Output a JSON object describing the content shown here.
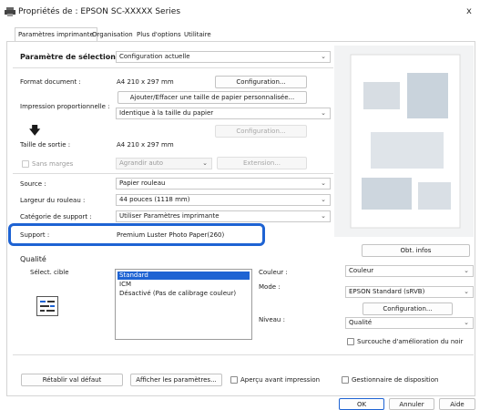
{
  "window": {
    "title": "Propriétés de : EPSON SC-XXXXX Series",
    "close_label": "x"
  },
  "tabs": [
    {
      "label": "Paramètres imprimante"
    },
    {
      "label": "Organisation"
    },
    {
      "label": "Plus d'options"
    },
    {
      "label": "Utilitaire"
    }
  ],
  "selection": {
    "label": "Paramètre de sélection :",
    "value": "Configuration actuelle"
  },
  "format": {
    "label": "Format document :",
    "value": "A4 210 x 297 mm",
    "config_button": "Configuration..."
  },
  "custom_size_button": "Ajouter/Effacer une taille de papier personnalisée...",
  "proportional": {
    "label": "Impression proportionnelle :",
    "value": "Identique à la taille du papier",
    "config_button": "Configuration..."
  },
  "arrow_glyph": "🡇",
  "output": {
    "label": "Taille de sortie :",
    "value": "A4 210 x 297 mm"
  },
  "borderless": {
    "label": "Sans marges",
    "enlarge_value": "Agrandir auto",
    "extension_button": "Extension..."
  },
  "source": {
    "label": "Source :",
    "value": "Papier rouleau"
  },
  "roll_width": {
    "label": "Largeur du rouleau :",
    "value": "44 pouces (1118 mm)"
  },
  "media_category": {
    "label": "Catégorie de support :",
    "value": "Utiliser Paramètres imprimante"
  },
  "support": {
    "label": "Support :",
    "value": "Premium Luster Photo Paper(260)"
  },
  "obtain_info_button": "Obt. infos",
  "quality": {
    "section_label": "Qualité",
    "target_label": "Sélect. cible",
    "targets": [
      "Standard",
      "ICM",
      "Désactivé (Pas de calibrage couleur)"
    ],
    "selected_index": 0
  },
  "color": {
    "label": "Couleur :",
    "value": "Couleur"
  },
  "mode": {
    "label": "Mode :",
    "value": "EPSON Standard (sRVB)",
    "config_button": "Configuration..."
  },
  "level": {
    "label": "Niveau :",
    "value": "Qualité"
  },
  "black_enhance": {
    "label": "Surcouche d'amélioration du noir"
  },
  "footer": {
    "reset_button": "Rétablir val défaut",
    "show_settings_button": "Afficher les paramètres...",
    "preview_label": "Aperçu avant impression",
    "layout_manager_label": "Gestionnaire de disposition"
  },
  "dialog": {
    "ok": "OK",
    "cancel": "Annuler",
    "help": "Aide"
  },
  "accent_color": "#1e63d3"
}
